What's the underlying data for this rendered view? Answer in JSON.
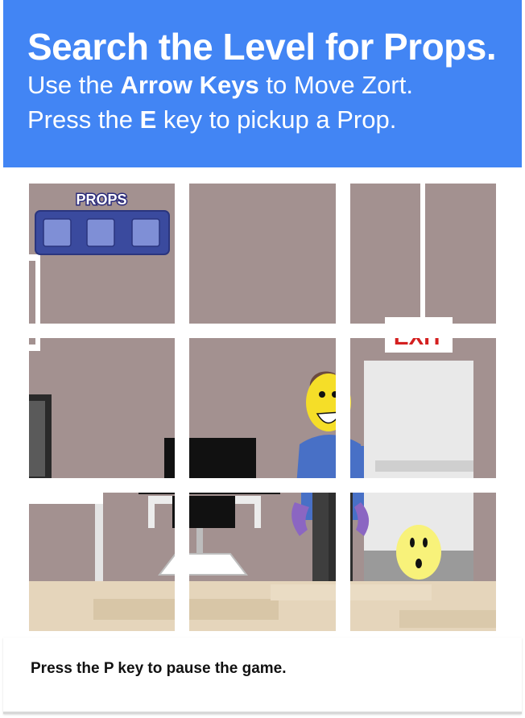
{
  "instructions": {
    "title": "Search the Level for Props.",
    "line1_pre": "Use the ",
    "line1_key": "Arrow Keys",
    "line1_post": " to Move Zort.",
    "line2_pre": "Press the ",
    "line2_key": "E",
    "line2_post": " key to pickup a Prop."
  },
  "hud": {
    "props_label": "PROPS",
    "slots": [
      "empty",
      "empty",
      "empty"
    ]
  },
  "scene": {
    "exit_sign": "EXIT",
    "character": "zort",
    "prop_visible": "yellow-face-ball"
  },
  "footer": {
    "text": "Press the P key to pause the game."
  },
  "colors": {
    "banner": "#4285f4",
    "wall": "#a39190",
    "floor": "#e5d5bb",
    "hud_panel": "#3a4a9e",
    "hud_slot": "#7f8fd6"
  }
}
